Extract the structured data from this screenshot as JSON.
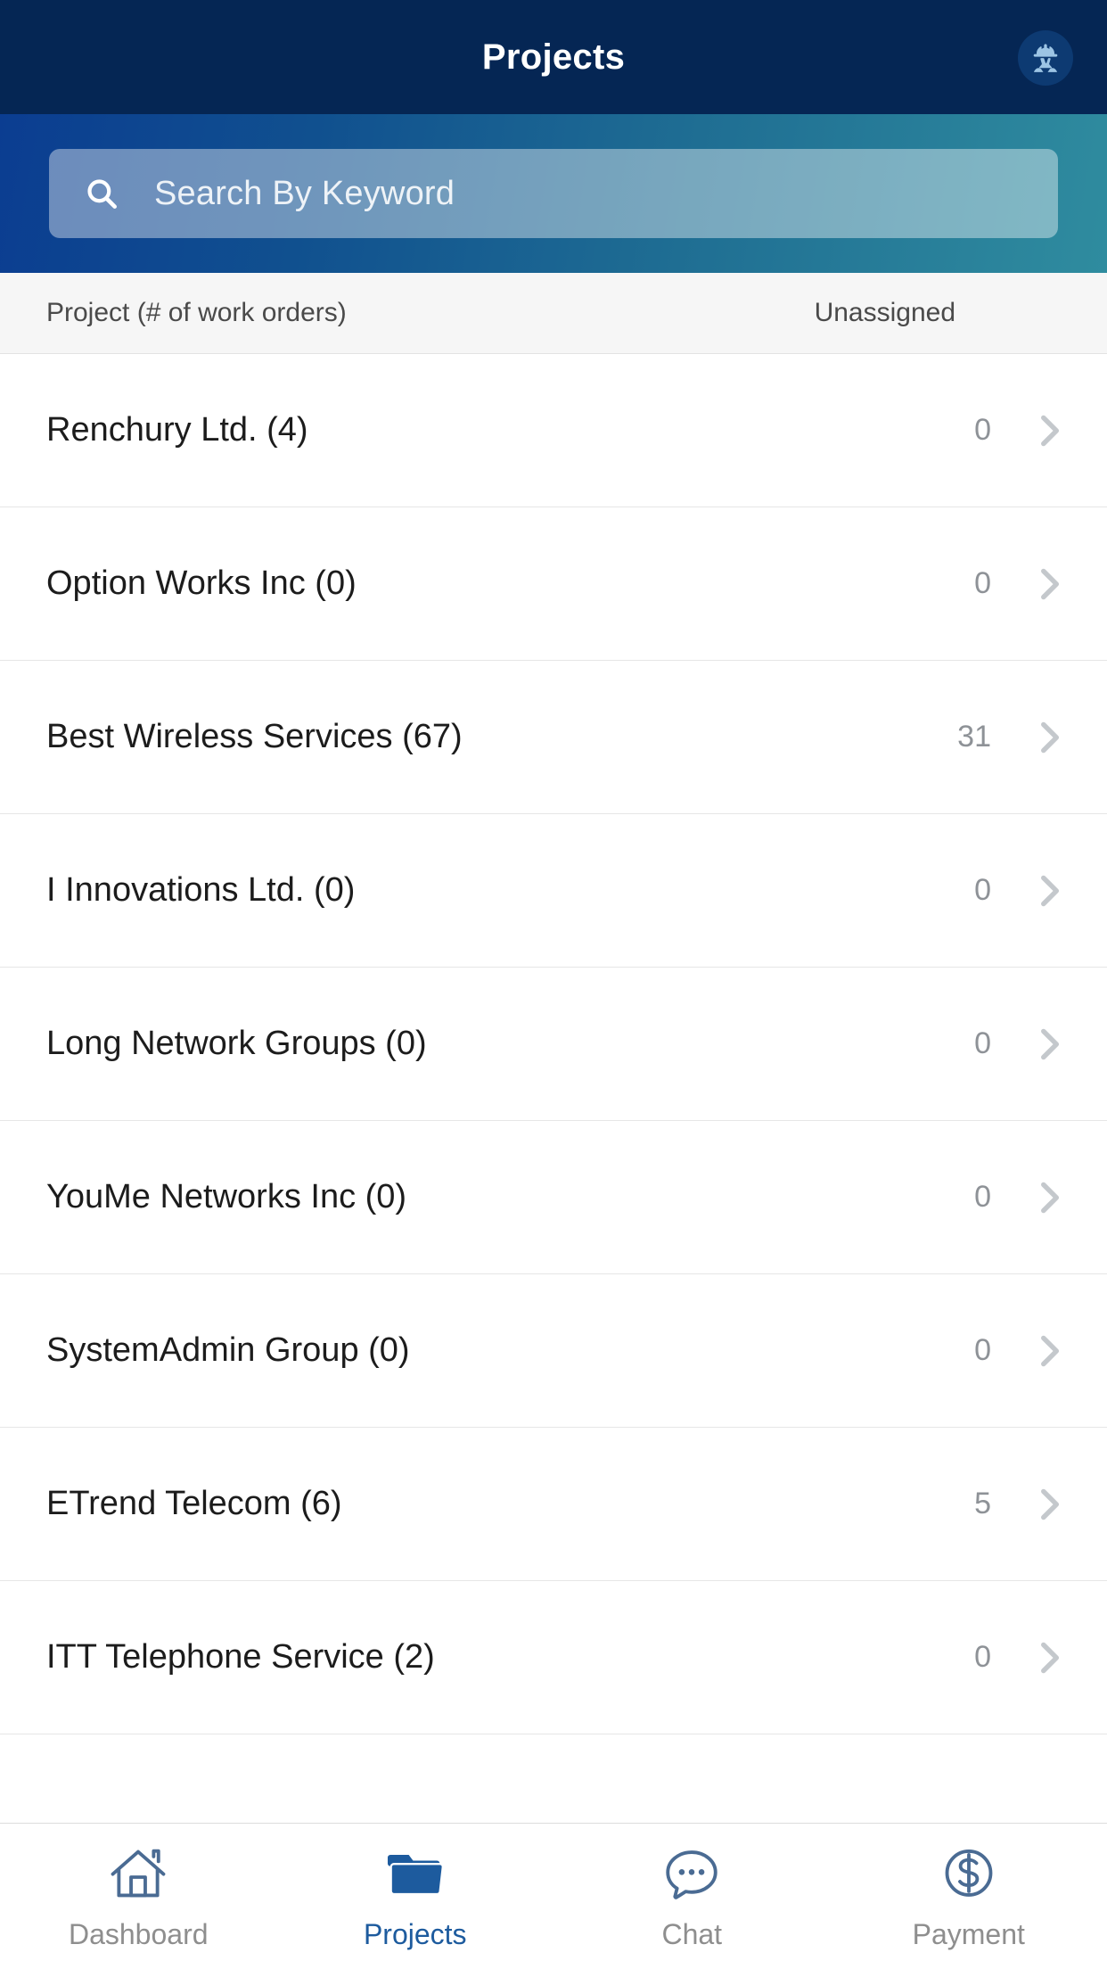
{
  "header": {
    "title": "Projects",
    "avatar_icon": "worker-helmet-icon"
  },
  "search": {
    "placeholder": "Search By Keyword",
    "value": "",
    "icon": "search-icon"
  },
  "list_header": {
    "project_column": "Project (# of work orders)",
    "unassigned_column": "Unassigned"
  },
  "rows": [
    {
      "name": "Renchury Ltd. (4)",
      "unassigned": "0"
    },
    {
      "name": "Option Works Inc (0)",
      "unassigned": "0"
    },
    {
      "name": "Best Wireless Services (67)",
      "unassigned": "31"
    },
    {
      "name": "I Innovations Ltd. (0)",
      "unassigned": "0"
    },
    {
      "name": "Long Network Groups (0)",
      "unassigned": "0"
    },
    {
      "name": "YouMe Networks Inc (0)",
      "unassigned": "0"
    },
    {
      "name": "SystemAdmin Group (0)",
      "unassigned": "0"
    },
    {
      "name": "ETrend Telecom (6)",
      "unassigned": "5"
    },
    {
      "name": "ITT Telephone Service (2)",
      "unassigned": "0"
    }
  ],
  "tabbar": {
    "items": [
      {
        "label": "Dashboard",
        "icon": "home-icon",
        "active": false
      },
      {
        "label": "Projects",
        "icon": "folder-icon",
        "active": true
      },
      {
        "label": "Chat",
        "icon": "chat-bubble-icon",
        "active": false
      },
      {
        "label": "Payment",
        "icon": "dollar-circle-icon",
        "active": false
      }
    ]
  },
  "colors": {
    "header_bg": "#052654",
    "gradient_start": "#0b3d91",
    "gradient_end": "#2f8c9f",
    "accent": "#1d5b9e",
    "inactive_label": "#8e8e8e",
    "chevron": "#c4c8cc",
    "count_text": "#8e9297"
  }
}
